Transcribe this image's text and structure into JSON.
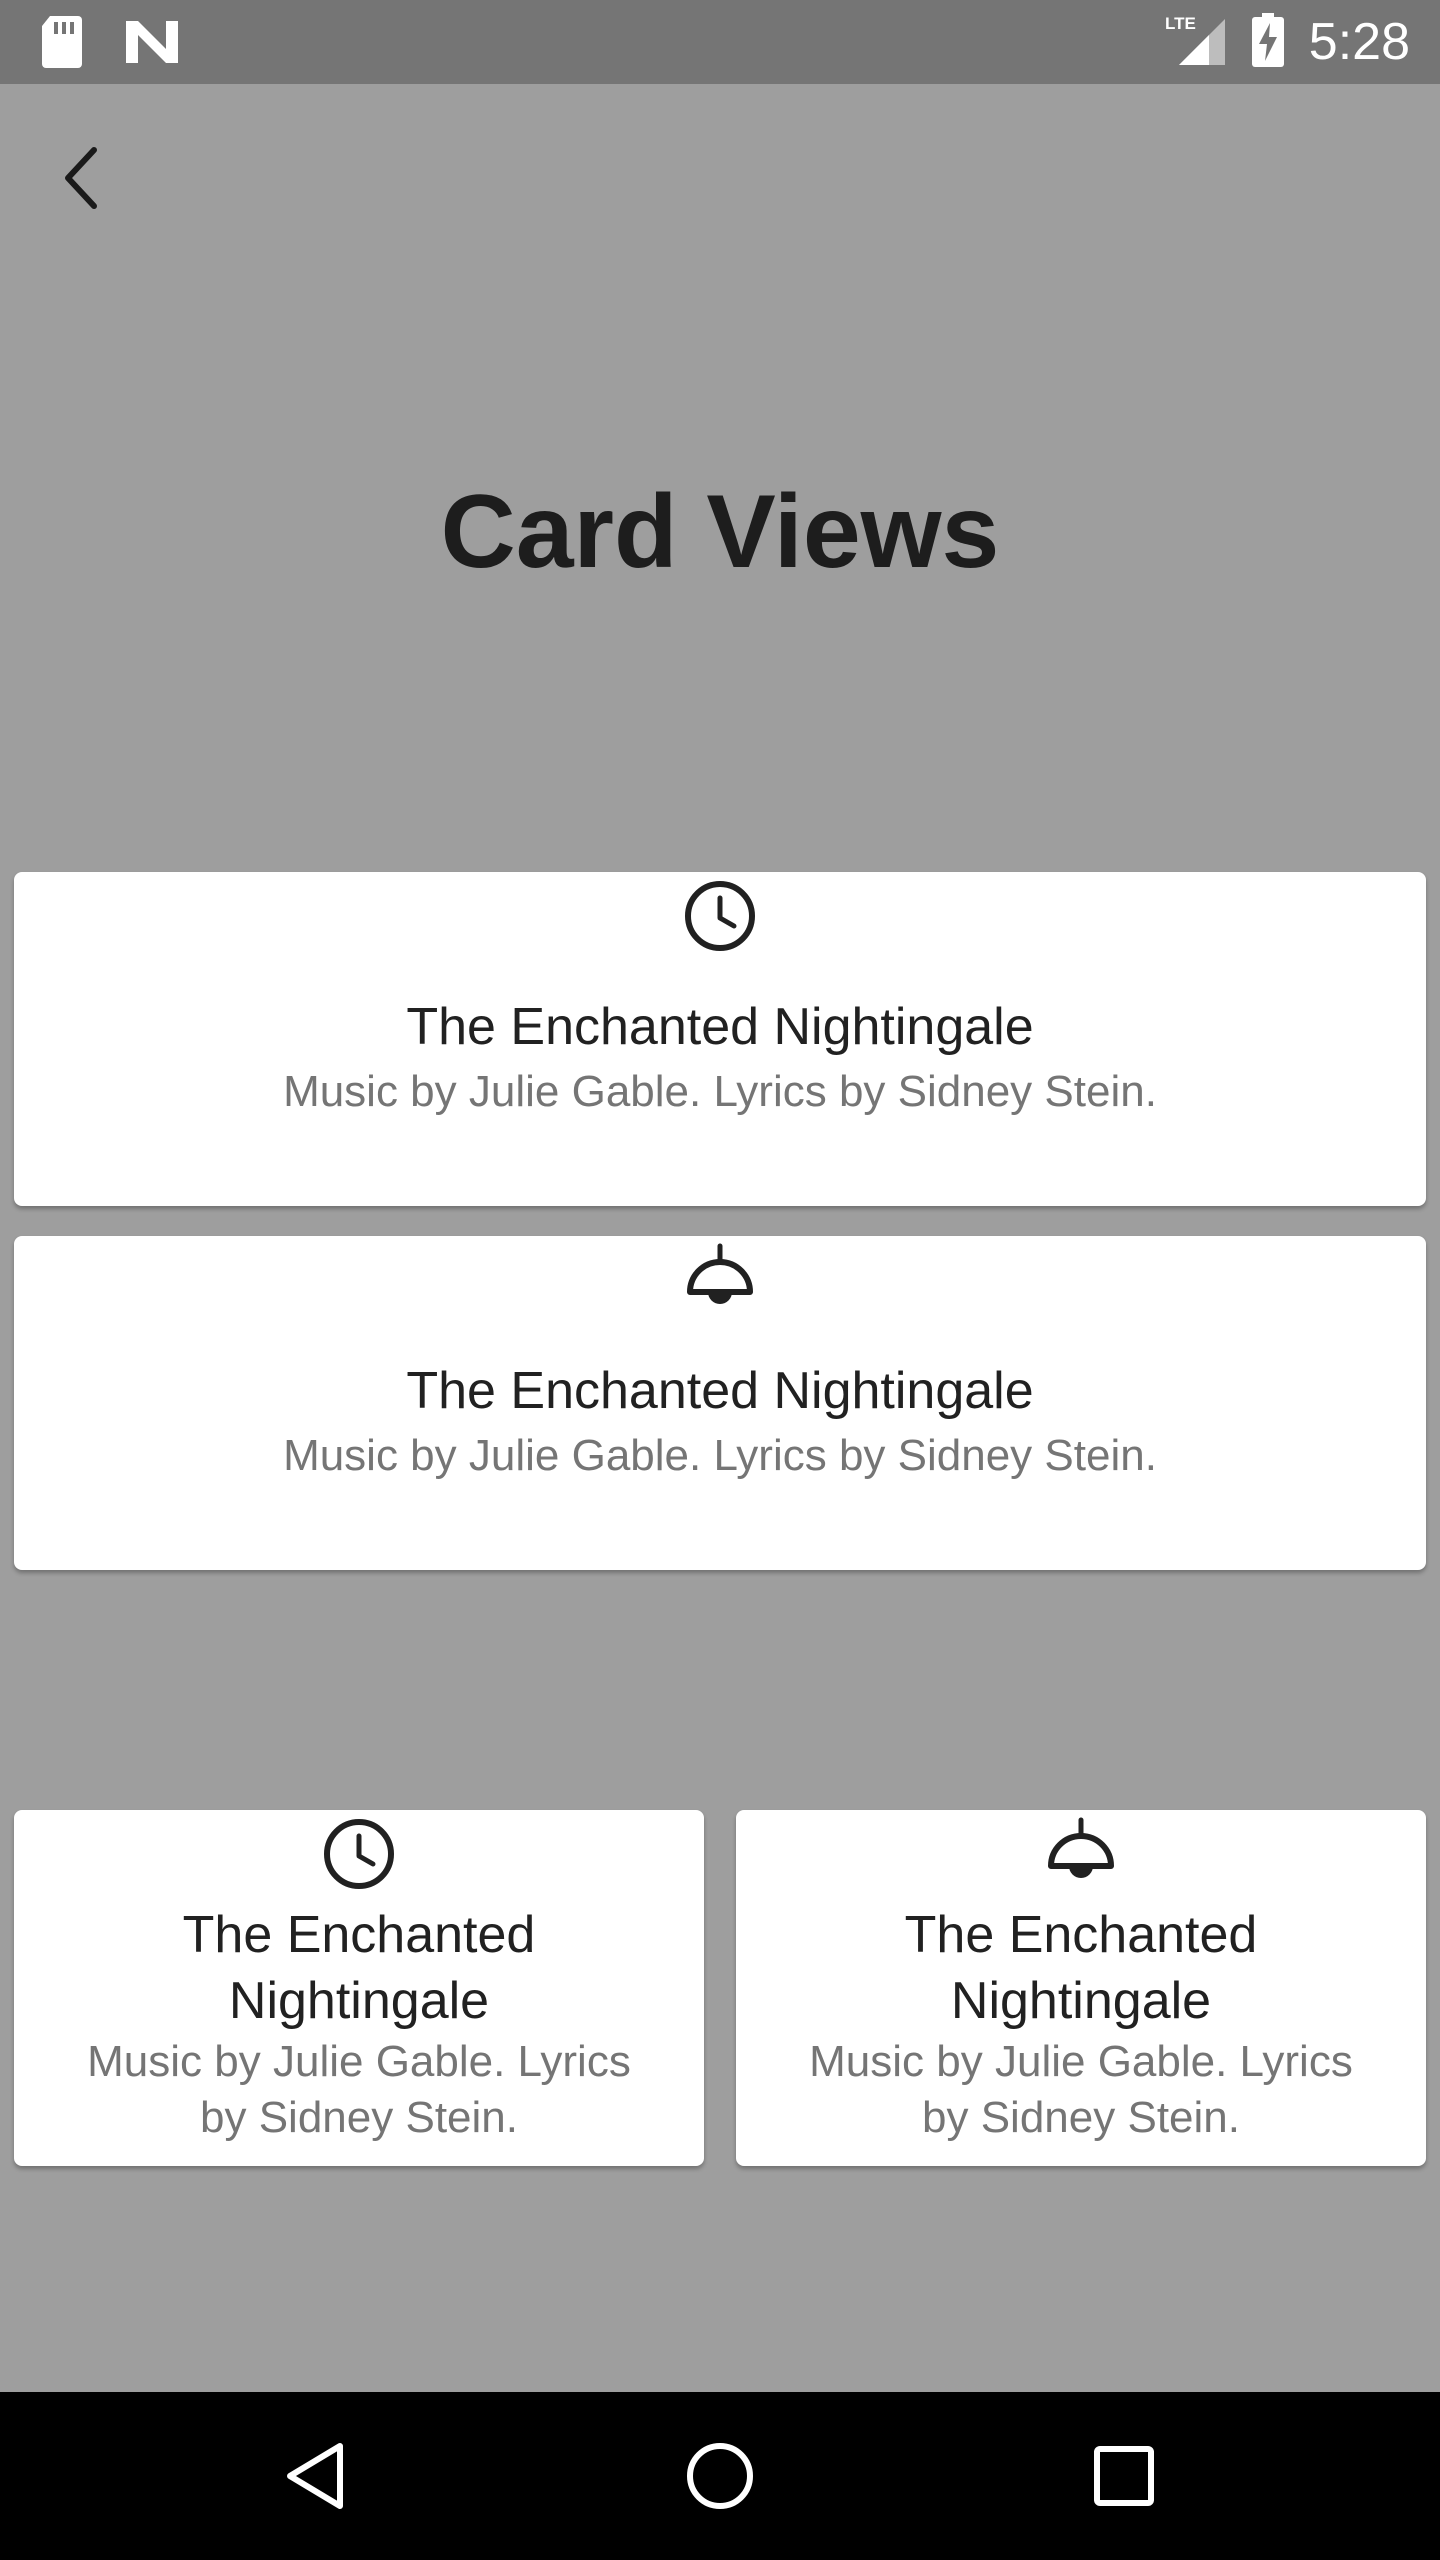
{
  "status_bar": {
    "time": "5:28",
    "network": "LTE",
    "icons": [
      "sd-card-icon",
      "n-logo-icon",
      "signal-icon",
      "battery-charging-icon"
    ]
  },
  "toolbar": {
    "back_icon": "chevron-left-icon"
  },
  "page": {
    "title": "Card Views"
  },
  "cards_wide": [
    {
      "icon": "clock-icon",
      "title": "The Enchanted Nightingale",
      "subtitle": "Music by Julie Gable. Lyrics by Sidney Stein."
    },
    {
      "icon": "lamp-icon",
      "title": "The Enchanted Nightingale",
      "subtitle": "Music by Julie Gable. Lyrics by Sidney Stein."
    }
  ],
  "cards_half": [
    {
      "icon": "clock-icon",
      "title": "The Enchanted Nightingale",
      "subtitle": "Music by Julie Gable. Lyrics by Sidney Stein."
    },
    {
      "icon": "lamp-icon",
      "title": "The Enchanted Nightingale",
      "subtitle": "Music by Julie Gable. Lyrics by Sidney Stein."
    }
  ],
  "nav_bar": {
    "icons": [
      "nav-back-icon",
      "nav-home-icon",
      "nav-recents-icon"
    ]
  },
  "colors": {
    "background": "#9e9e9e",
    "status_bar": "#757575",
    "card": "#ffffff",
    "title_text": "#212121",
    "subtitle_text": "#757575",
    "nav_bar": "#000000"
  }
}
